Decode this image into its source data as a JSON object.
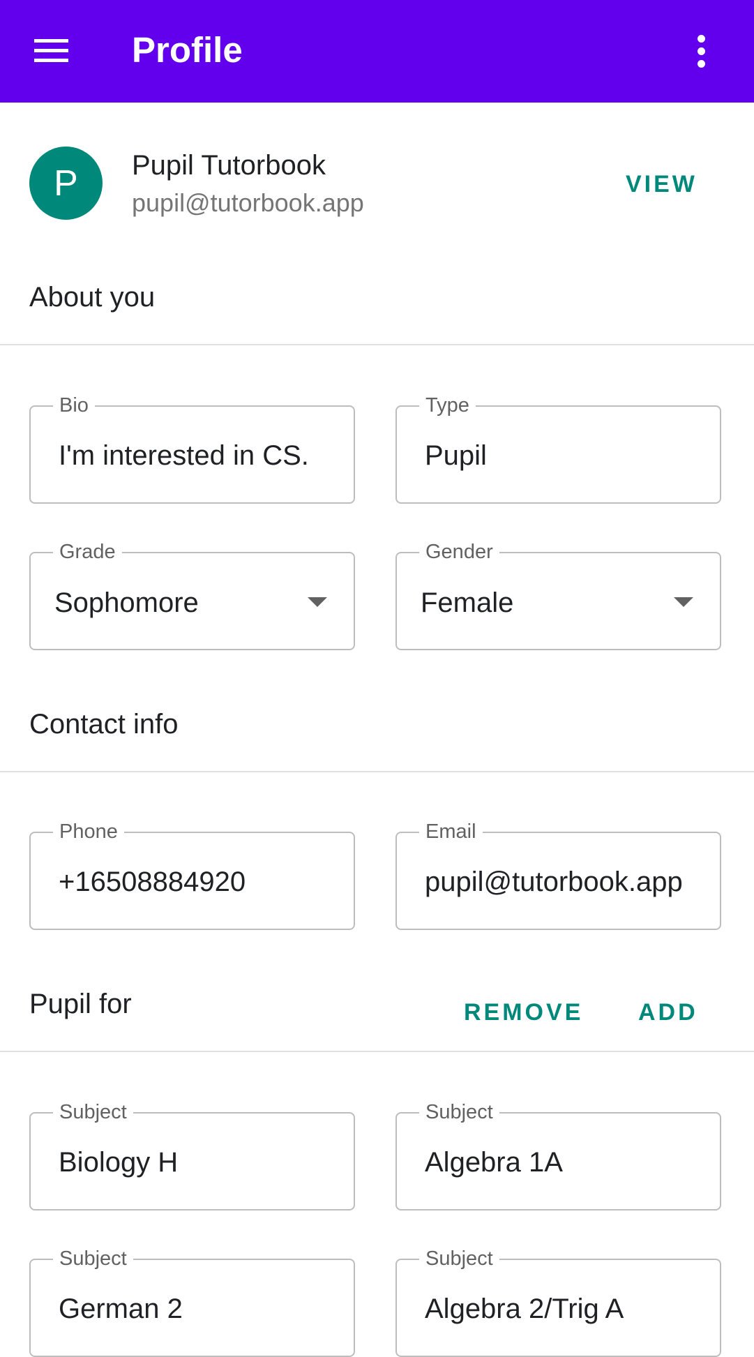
{
  "appbar": {
    "title": "Profile",
    "menu_icon": "hamburger-menu-icon",
    "more_icon": "more-vert-icon",
    "color": "#6200ee"
  },
  "user": {
    "avatar_letter": "P",
    "name": "Pupil Tutorbook",
    "email": "pupil@tutorbook.app",
    "view_label": "VIEW",
    "avatar_color": "#00897b"
  },
  "about": {
    "title": "About you",
    "bio": {
      "label": "Bio",
      "value": "I'm interested in CS."
    },
    "type": {
      "label": "Type",
      "value": "Pupil"
    },
    "grade": {
      "label": "Grade",
      "value": "Sophomore"
    },
    "gender": {
      "label": "Gender",
      "value": "Female"
    }
  },
  "contact": {
    "title": "Contact info",
    "phone": {
      "label": "Phone",
      "value": "+16508884920"
    },
    "email": {
      "label": "Email",
      "value": "pupil@tutorbook.app"
    }
  },
  "pupil_for": {
    "title": "Pupil for",
    "remove_label": "REMOVE",
    "add_label": "ADD",
    "subjects": [
      {
        "label": "Subject",
        "value": "Biology H"
      },
      {
        "label": "Subject",
        "value": "Algebra 1A"
      },
      {
        "label": "Subject",
        "value": "German 2"
      },
      {
        "label": "Subject",
        "value": "Algebra 2/Trig A"
      }
    ]
  },
  "accent_color": "#00897b"
}
